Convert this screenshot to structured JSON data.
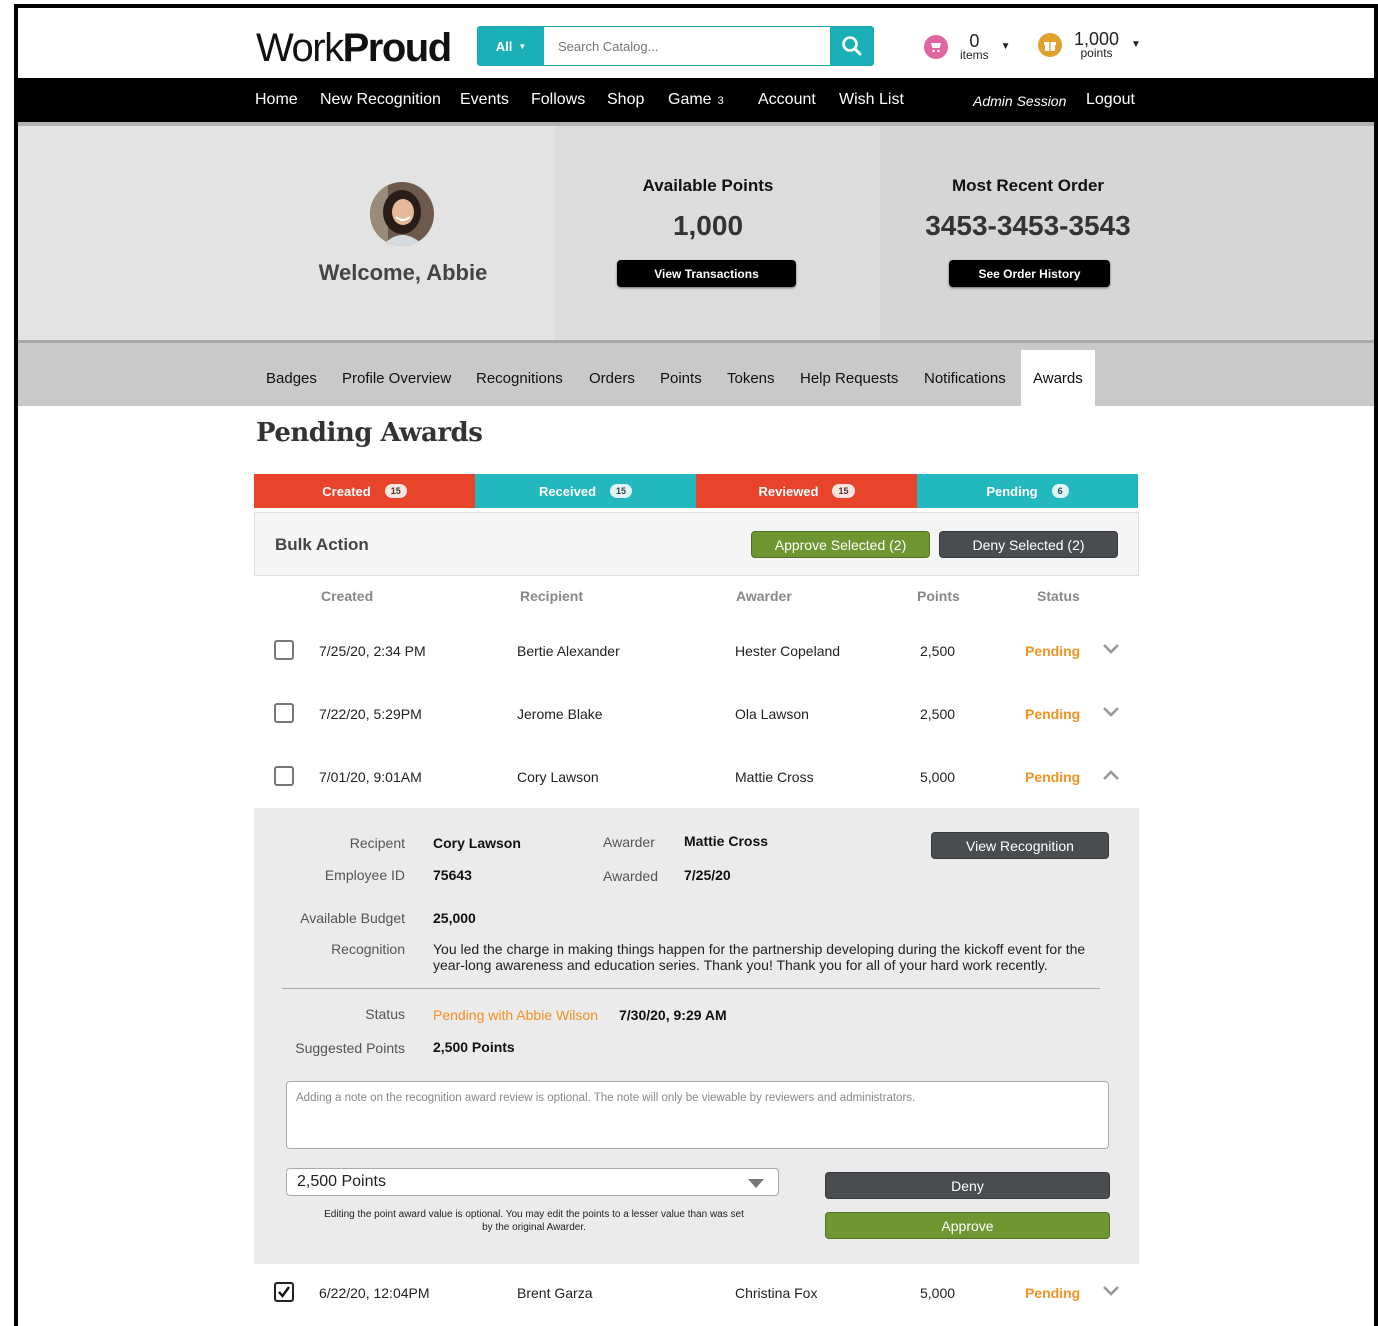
{
  "header": {
    "logo_light": "Work",
    "logo_bold": "Proud",
    "search_scope": "All",
    "search_placeholder": "Search Catalog...",
    "cart_count": "0",
    "cart_unit": "items",
    "points_count": "1,000",
    "points_unit": "points"
  },
  "nav": {
    "items": [
      "Home",
      "New Recognition",
      "Events",
      "Follows",
      "Shop",
      "Game",
      "Account",
      "Wish List"
    ],
    "game_count": "3",
    "admin_session": "Admin Session",
    "logout": "Logout"
  },
  "hero": {
    "welcome": "Welcome, Abbie",
    "available_title": "Available Points",
    "available_value": "1,000",
    "view_transactions": "View Transactions",
    "recent_title": "Most Recent Order",
    "recent_value": "3453-3453-3543",
    "order_history": "See Order History"
  },
  "profile_tabs": [
    "Badges",
    "Profile Overview",
    "Recognitions",
    "Orders",
    "Points",
    "Tokens",
    "Help Requests",
    "Notifications",
    "Awards"
  ],
  "page_title": "Pending Awards",
  "status_tabs": [
    {
      "label": "Created",
      "count": "15"
    },
    {
      "label": "Received",
      "count": "15"
    },
    {
      "label": "Reviewed",
      "count": "15"
    },
    {
      "label": "Pending",
      "count": "6"
    }
  ],
  "bulk": {
    "label": "Bulk Action",
    "approve": "Approve Selected (2)",
    "deny": "Deny Selected (2)"
  },
  "columns": [
    "Created",
    "Recipient",
    "Awarder",
    "Points",
    "Status"
  ],
  "rows": [
    {
      "created": "7/25/20, 2:34 PM",
      "recipient": "Bertie Alexander",
      "awarder": "Hester Copeland",
      "points": "2,500",
      "status": "Pending"
    },
    {
      "created": "7/22/20, 5:29PM",
      "recipient": "Jerome Blake",
      "awarder": "Ola Lawson",
      "points": "2,500",
      "status": "Pending"
    },
    {
      "created": "7/01/20, 9:01AM",
      "recipient": "Cory Lawson",
      "awarder": "Mattie Cross",
      "points": "5,000",
      "status": "Pending"
    },
    {
      "created": "6/22/20, 12:04PM",
      "recipient": "Brent Garza",
      "awarder": "Christina Fox",
      "points": "5,000",
      "status": "Pending"
    }
  ],
  "detail": {
    "recipient_label": "Recipent",
    "recipient": "Cory Lawson",
    "awarder_label": "Awarder",
    "awarder": "Mattie Cross",
    "view_recognition": "View Recognition",
    "employee_id_label": "Employee ID",
    "employee_id": "75643",
    "awarded_label": "Awarded",
    "awarded": "7/25/20",
    "budget_label": "Available Budget",
    "budget": "25,000",
    "recognition_label": "Recognition",
    "recognition": "You led the charge in making things happen for the partnership developing during the kickoff event for the year-long awareness and education series. Thank you! Thank you for all of your hard work recently.",
    "status_label": "Status",
    "status": "Pending with Abbie Wilson",
    "status_time": "7/30/20, 9:29 AM",
    "suggested_label": "Suggested Points",
    "suggested": "2,500 Points",
    "note_placeholder": "Adding a note on the recognition award review is optional. The note will only be viewable by reviewers and administrators.",
    "points_select": "2,500 Points",
    "hint": "Editing the point award value is optional. You may edit the points to a lesser value than was set by the original Awarder.",
    "deny": "Deny",
    "approve": "Approve"
  },
  "colors": {
    "teal": "#22b8bd",
    "red": "#e8432b",
    "orange": "#f29221",
    "green": "#6e9732"
  }
}
